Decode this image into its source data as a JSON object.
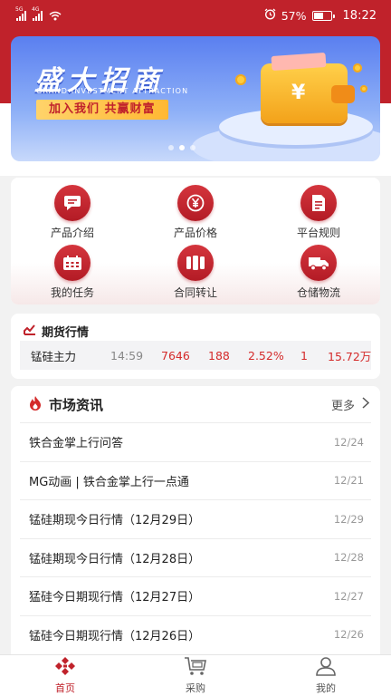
{
  "status_bar": {
    "network1": "5G",
    "network2": "4G",
    "battery": "57%",
    "battery_level": 0.57,
    "time": "18:22"
  },
  "banner": {
    "title": "盛大招商",
    "subtitle": "GRAND INVESTMENT ATTRACTION",
    "slogan": "加入我们  共赢财富",
    "wallet_symbol": "¥",
    "page_count": 3,
    "active_page": 2
  },
  "functions": [
    {
      "label": "产品介绍",
      "icon": "chat-bubble-icon"
    },
    {
      "label": "产品价格",
      "icon": "yen-coin-icon"
    },
    {
      "label": "平台规则",
      "icon": "document-icon"
    },
    {
      "label": "我的任务",
      "icon": "task-list-icon"
    },
    {
      "label": "合同转让",
      "icon": "contract-icon"
    },
    {
      "label": "仓储物流",
      "icon": "truck-icon"
    }
  ],
  "futures": {
    "title": "期货行情",
    "row": {
      "name": "锰硅主力",
      "time": "14:59",
      "price": "7646",
      "change": "188",
      "percent": "2.52%",
      "volume": "1",
      "amount": "15.72万"
    }
  },
  "news": {
    "title": "市场资讯",
    "more": "更多",
    "items": [
      {
        "title": "铁合金掌上行问答",
        "date": "12/24"
      },
      {
        "title": "MG动画 | 铁合金掌上行一点通",
        "date": "12/21"
      },
      {
        "title": "锰硅期现今日行情（12月29日）",
        "date": "12/29"
      },
      {
        "title": "锰硅期现今日行情（12月28日）",
        "date": "12/28"
      },
      {
        "title": "猛硅今日期现行情（12月27日）",
        "date": "12/27"
      },
      {
        "title": "锰硅今日期现行情（12月26日）",
        "date": "12/26"
      }
    ]
  },
  "bottom_nav": [
    {
      "label": "首页",
      "icon": "home-logo-icon",
      "active": true
    },
    {
      "label": "采购",
      "icon": "cart-icon",
      "active": false
    },
    {
      "label": "我的",
      "icon": "user-icon",
      "active": false
    }
  ],
  "colors": {
    "brand": "#c0222b",
    "accent": "#d42a2a",
    "banner": "#5a7ff0"
  }
}
